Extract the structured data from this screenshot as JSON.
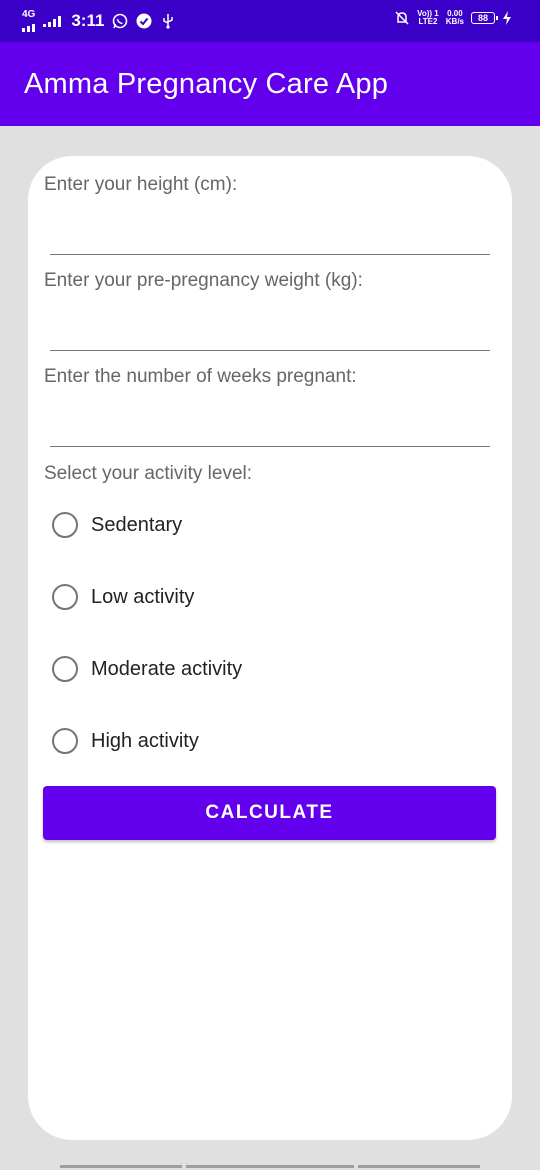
{
  "status_bar": {
    "network": "4G",
    "time": "3:11",
    "volte": "Vo)) 1",
    "lte": "LTE2",
    "speed_value": "0.00",
    "speed_unit": "KB/s",
    "battery": "88"
  },
  "app_bar": {
    "title": "Amma Pregnancy Care App"
  },
  "form": {
    "height_label": "Enter your height (cm):",
    "weight_label": "Enter your pre-pregnancy weight (kg):",
    "weeks_label": "Enter the number of weeks pregnant:",
    "activity_label": "Select your activity level:",
    "activity_options": [
      {
        "label": "Sedentary",
        "selected": false
      },
      {
        "label": "Low activity",
        "selected": false
      },
      {
        "label": "Moderate activity",
        "selected": false
      },
      {
        "label": "High activity",
        "selected": false
      }
    ],
    "calculate_label": "CALCULATE"
  },
  "colors": {
    "status_bar": "#3a00c8",
    "primary": "#6200ee",
    "background": "#e0e0e0",
    "card": "#ffffff"
  }
}
